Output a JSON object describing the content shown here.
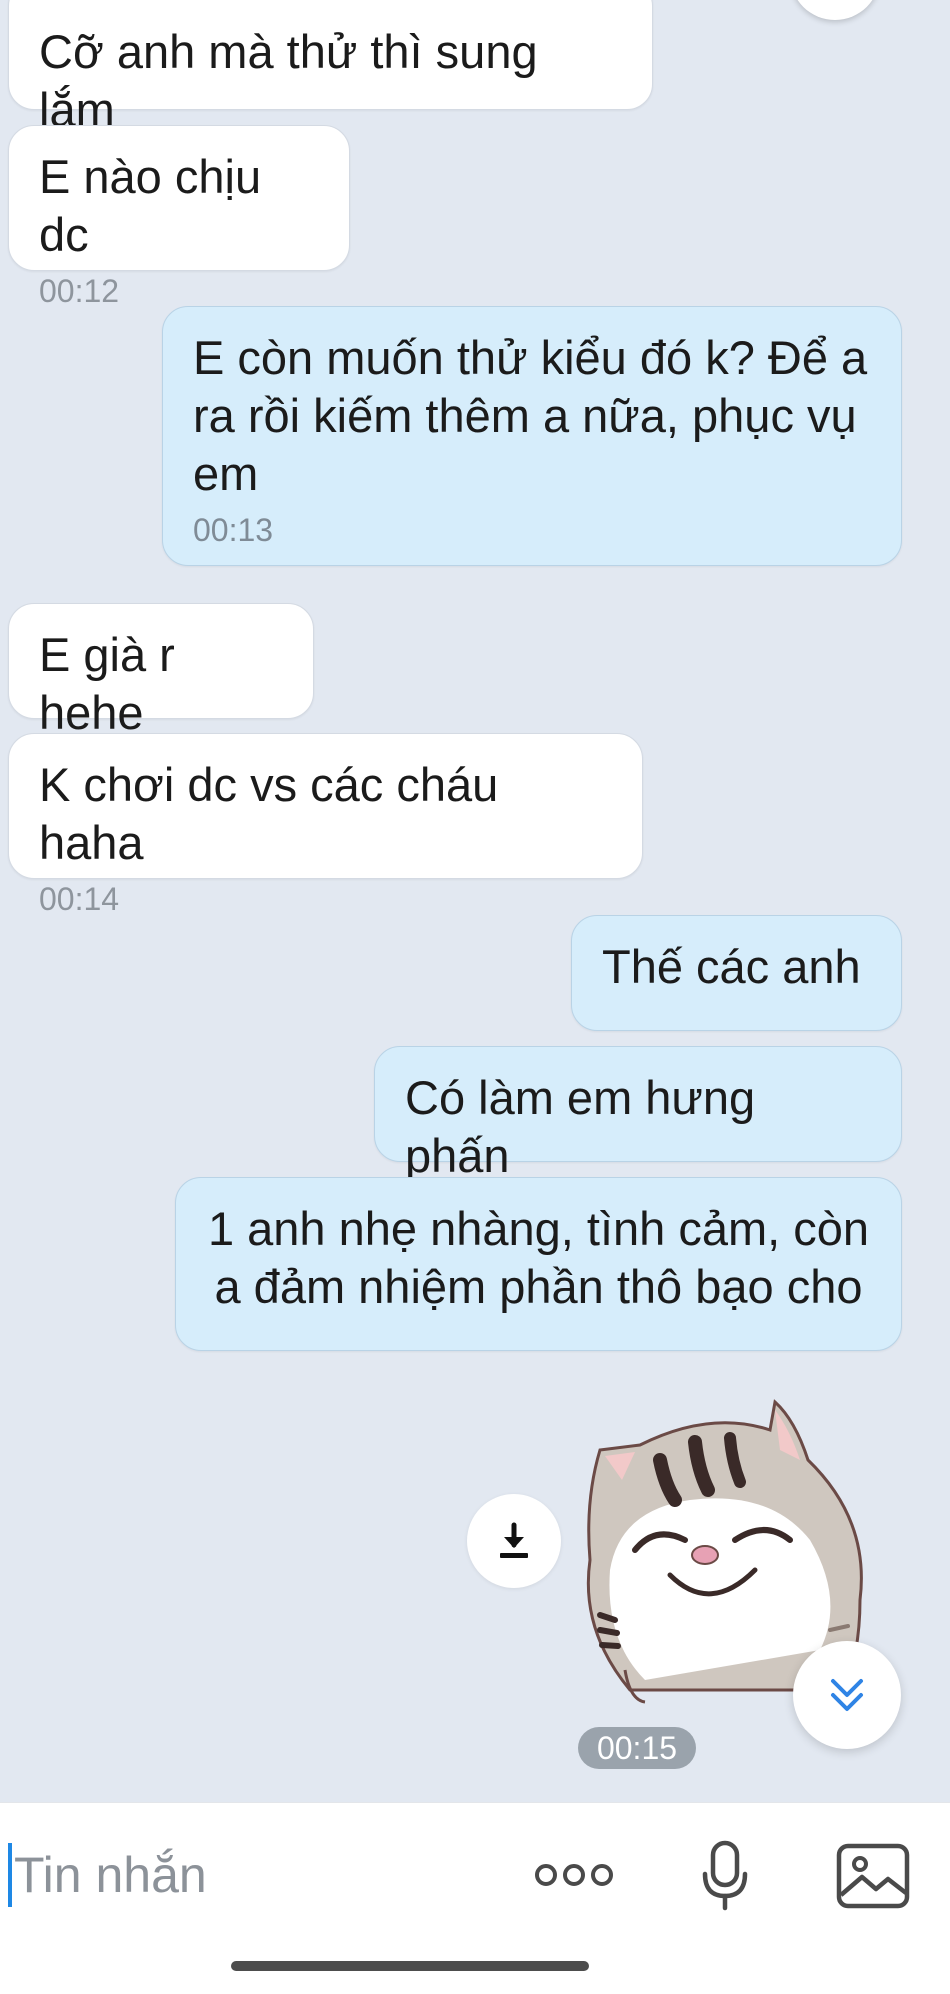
{
  "messages": [
    {
      "text": "Cỡ anh mà thử thì sung lắm",
      "time": ""
    },
    {
      "text": "E nào chịu dc",
      "time": "00:12"
    },
    {
      "text": "E còn muốn thử kiểu đó k? Để a ra rồi kiếm thêm a nữa, phục vụ em",
      "time": "00:13"
    },
    {
      "text": "E già r hehe",
      "time": ""
    },
    {
      "text": "K chơi dc vs các cháu haha",
      "time": "00:14"
    },
    {
      "text": "Thế các anh",
      "time": ""
    },
    {
      "text": "Có làm em hưng phấn",
      "time": ""
    },
    {
      "text": "1 anh nhẹ nhàng, tình cảm, còn a đảm nhiệm phần thô bạo cho",
      "time": ""
    }
  ],
  "sticker": {
    "time": "00:15",
    "icon": "cat-sticker"
  },
  "composer": {
    "placeholder": "Tin nhắn"
  },
  "icons": [
    "download-icon",
    "chevron-double-down-icon",
    "more-icon",
    "microphone-icon",
    "image-icon"
  ],
  "colors": {
    "background": "#e2e8f1",
    "incoming": "#ffffff",
    "outgoing": "#d6edfb",
    "accent": "#1e88e5"
  }
}
